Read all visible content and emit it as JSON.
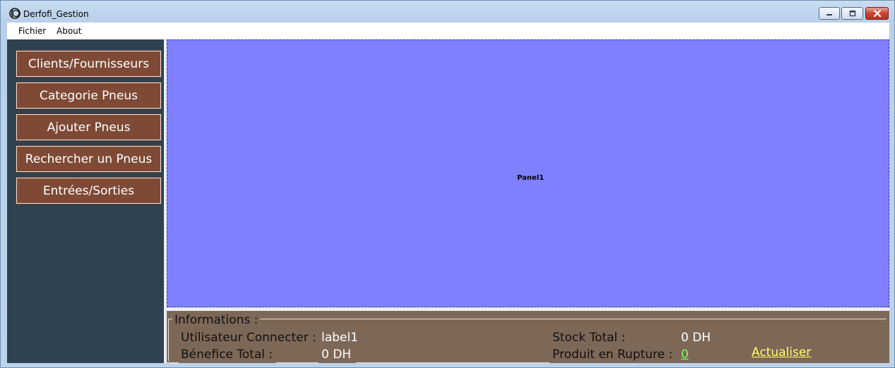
{
  "window": {
    "title": "Derfofi_Gestion"
  },
  "menu": {
    "items": [
      {
        "label": "Fichier"
      },
      {
        "label": "About"
      }
    ]
  },
  "sidebar": {
    "buttons": [
      {
        "label": "Clients/Fournisseurs"
      },
      {
        "label": "Categorie Pneus"
      },
      {
        "label": "Ajouter Pneus"
      },
      {
        "label": "Rechercher un Pneus"
      },
      {
        "label": "Entrées/Sorties"
      }
    ]
  },
  "main_panel": {
    "label": "Panel1",
    "background": "#8080ff"
  },
  "informations": {
    "title": "Informations :",
    "user_label": "Utilisateur Connecter :",
    "user_value": "label1",
    "benefit_label": "Bénefice Total :",
    "benefit_value": "0 DH",
    "stock_label": "Stock Total :",
    "stock_value": "0 DH",
    "rupture_label": "Produit en Rupture :",
    "rupture_value": "0",
    "refresh_label": "Actualiser"
  },
  "colors": {
    "sidebar_bg": "#2f4250",
    "button_bg": "#7e4a35",
    "info_bg": "#7d6858",
    "link_color": "#ffff66",
    "rupture_color": "#7cff5a"
  },
  "icons": [
    "app-icon",
    "minimize-icon",
    "maximize-icon",
    "close-icon"
  ]
}
